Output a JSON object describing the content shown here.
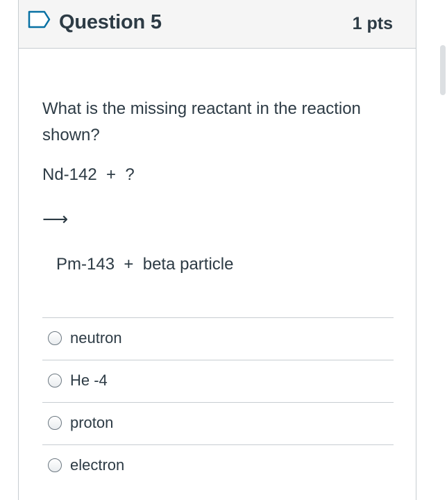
{
  "question": {
    "title": "Question 5",
    "points": "1 pts",
    "prompt": "What is the missing reactant in the reaction shown?",
    "equation_reactants": "Nd-142  +  ?",
    "arrow": "⟶",
    "equation_products": "Pm-143  +  beta particle"
  },
  "answers": [
    {
      "label": "neutron"
    },
    {
      "label": "He -4"
    },
    {
      "label": "proton"
    },
    {
      "label": "electron"
    }
  ],
  "icons": {
    "flag": "bookmark-flag-icon"
  },
  "colors": {
    "flag": "#0770a3",
    "text": "#2d3b45",
    "border": "#c7cdd1",
    "header_bg": "#f5f5f5"
  }
}
